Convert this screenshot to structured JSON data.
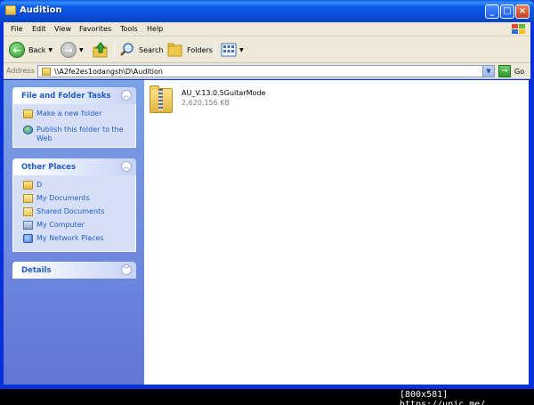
{
  "window": {
    "title": "Audition",
    "controls": {
      "minimize": "_",
      "maximize": "□",
      "close": "×"
    }
  },
  "menu": [
    "File",
    "Edit",
    "View",
    "Favorites",
    "Tools",
    "Help"
  ],
  "toolbar": {
    "back_label": "Back",
    "search_label": "Search",
    "folders_label": "Folders"
  },
  "address": {
    "label": "Address",
    "path": "\\\\A2fe2es1odangsh\\D\\Audition",
    "go_label": "Go"
  },
  "sidebar": {
    "file_tasks": {
      "title": "File and Folder Tasks",
      "items": [
        {
          "label": "Make a new folder",
          "icon": "new-folder-icon"
        },
        {
          "label": "Publish this folder to the Web",
          "icon": "globe-icon"
        }
      ]
    },
    "other_places": {
      "title": "Other Places",
      "items": [
        {
          "label": "D",
          "icon": "folder-icon"
        },
        {
          "label": "My Documents",
          "icon": "documents-icon"
        },
        {
          "label": "Shared Documents",
          "icon": "shared-documents-icon"
        },
        {
          "label": "My Computer",
          "icon": "computer-icon"
        },
        {
          "label": "My Network Places",
          "icon": "network-icon"
        }
      ]
    },
    "details": {
      "title": "Details"
    }
  },
  "files": [
    {
      "name": "AU_V.13.0.5GuitarMode",
      "size": "2,620,156 KB",
      "icon": "zip-folder-icon"
    }
  ],
  "watermark": "[800x581] https://upic.me/"
}
